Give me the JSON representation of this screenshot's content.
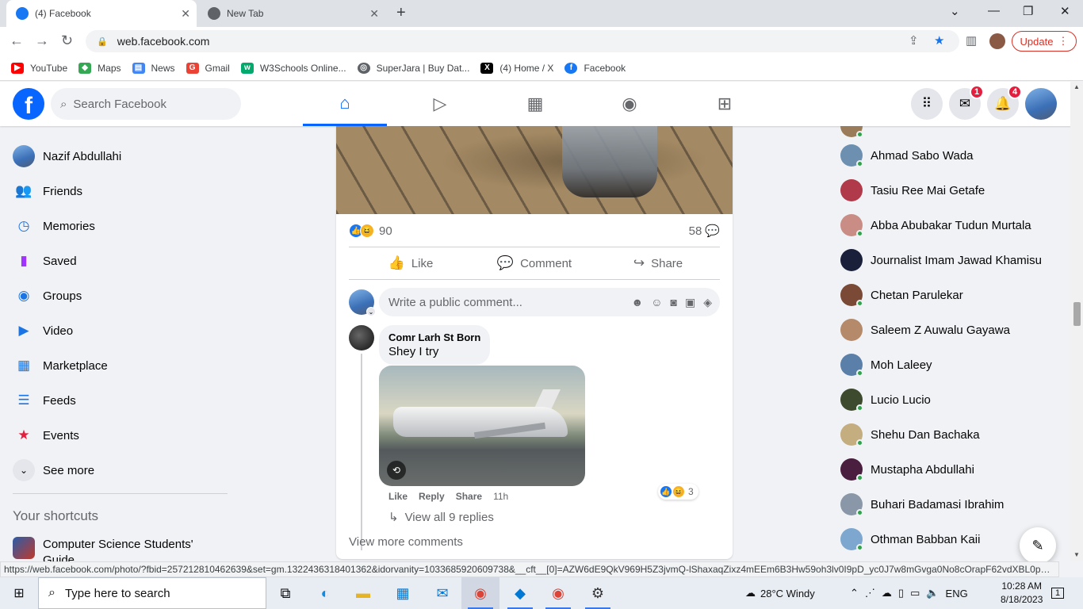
{
  "browser": {
    "tabs": [
      {
        "title": "(4) Facebook",
        "active": true
      },
      {
        "title": "New Tab",
        "active": false
      }
    ],
    "url": "web.facebook.com",
    "update_label": "Update",
    "bookmarks": [
      {
        "label": "YouTube",
        "icon": "youtube-icon",
        "color": "#ff0000"
      },
      {
        "label": "Maps",
        "icon": "maps-icon",
        "color": "#34a853"
      },
      {
        "label": "News",
        "icon": "news-icon",
        "color": "#4285f4"
      },
      {
        "label": "Gmail",
        "icon": "google-icon",
        "color": "#ea4335"
      },
      {
        "label": "W3Schools Online...",
        "icon": "w3schools-icon",
        "color": "#04aa6d"
      },
      {
        "label": "SuperJara | Buy Dat...",
        "icon": "globe-icon",
        "color": "#5f6368"
      },
      {
        "label": "(4) Home / X",
        "icon": "x-icon",
        "color": "#000000"
      },
      {
        "label": "Facebook",
        "icon": "facebook-icon",
        "color": "#1877f2"
      }
    ],
    "status_url": "https://web.facebook.com/photo/?fbid=257212810462639&set=gm.1322436318401362&idorvanity=1033685920609738&__cft__[0]=AZW6dE9QkV969H5Z3jvmQ-lShaxaqZixz4mEEm6B3Hw59oh3lv0I9pD_yc0J7w8mGvga0No8cOrapF62vdXBL0pV58q..."
  },
  "facebook": {
    "accent": "#0866ff",
    "search_placeholder": "Search Facebook",
    "nav_tabs": [
      "home",
      "watch",
      "marketplace",
      "groups",
      "gaming"
    ],
    "messenger_badge": "1",
    "notifications_badge": "4",
    "sidebar": {
      "items": [
        {
          "label": "Nazif Abdullahi",
          "icon": "profile-avatar"
        },
        {
          "label": "Friends",
          "icon": "friends-icon"
        },
        {
          "label": "Memories",
          "icon": "memories-icon"
        },
        {
          "label": "Saved",
          "icon": "saved-icon"
        },
        {
          "label": "Groups",
          "icon": "groups-icon"
        },
        {
          "label": "Video",
          "icon": "video-icon"
        },
        {
          "label": "Marketplace",
          "icon": "marketplace-icon"
        },
        {
          "label": "Feeds",
          "icon": "feeds-icon"
        },
        {
          "label": "Events",
          "icon": "events-icon"
        },
        {
          "label": "See more",
          "icon": "chevron-down-icon"
        }
      ],
      "shortcuts_title": "Your shortcuts",
      "shortcut": "Computer Science Students' Guide"
    },
    "post": {
      "reaction_count": "90",
      "comment_count": "58",
      "actions": [
        "Like",
        "Comment",
        "Share"
      ],
      "comment_placeholder": "Write a public comment...",
      "comment": {
        "author": "Comr Larh St Born",
        "text": "Shey I try",
        "meta": [
          "Like",
          "Reply",
          "Share"
        ],
        "time": "11h",
        "reaction_count": "3"
      },
      "view_replies": "View all 9 replies",
      "view_more": "View more comments"
    },
    "contacts": [
      "Ahmad Sabo Wada",
      "Tasiu Ree Mai Getafe",
      "Abba Abubakar Tudun Murtala",
      "Journalist Imam Jawad Khamisu",
      "Chetan Parulekar",
      "Saleem Z Auwalu Gayawa",
      "Moh Laleey",
      "Lucio Lucio",
      "Shehu Dan Bachaka",
      "Mustapha Abdullahi",
      "Buhari Badamasi Ibrahim",
      "Othman Babban Kaii"
    ]
  },
  "taskbar": {
    "search_placeholder": "Type here to search",
    "weather": "28°C  Windy",
    "language": "ENG",
    "time": "10:28 AM",
    "date": "8/18/2023",
    "notification_count": "1"
  }
}
